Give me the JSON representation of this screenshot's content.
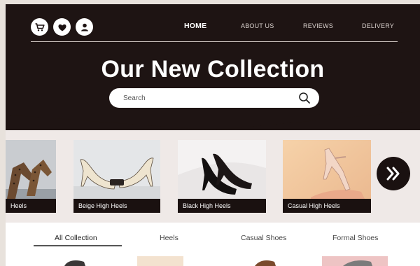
{
  "header": {
    "icons": [
      "cart-icon",
      "heart-icon",
      "user-icon"
    ],
    "nav": [
      "HOME",
      "ABOUT US",
      "REVIEWS",
      "DELIVERY"
    ],
    "active_nav": "HOME",
    "title": "Our New Collection",
    "search_placeholder": "Search"
  },
  "carousel": {
    "items": [
      {
        "label": "Heels"
      },
      {
        "label": "Beige High Heels"
      },
      {
        "label": "Black High Heels"
      },
      {
        "label": "Casual High Heels"
      }
    ],
    "next_icon": "double-chevron-right-icon"
  },
  "tabs": {
    "items": [
      "All Collection",
      "Heels",
      "Casual Shoes",
      "Formal Shoes"
    ],
    "active": "All Collection"
  },
  "colors": {
    "hero_bg": "#1e1413",
    "page_bg": "#efe9e7",
    "caption_bg": "#1a1110",
    "accent_white": "#ffffff"
  }
}
